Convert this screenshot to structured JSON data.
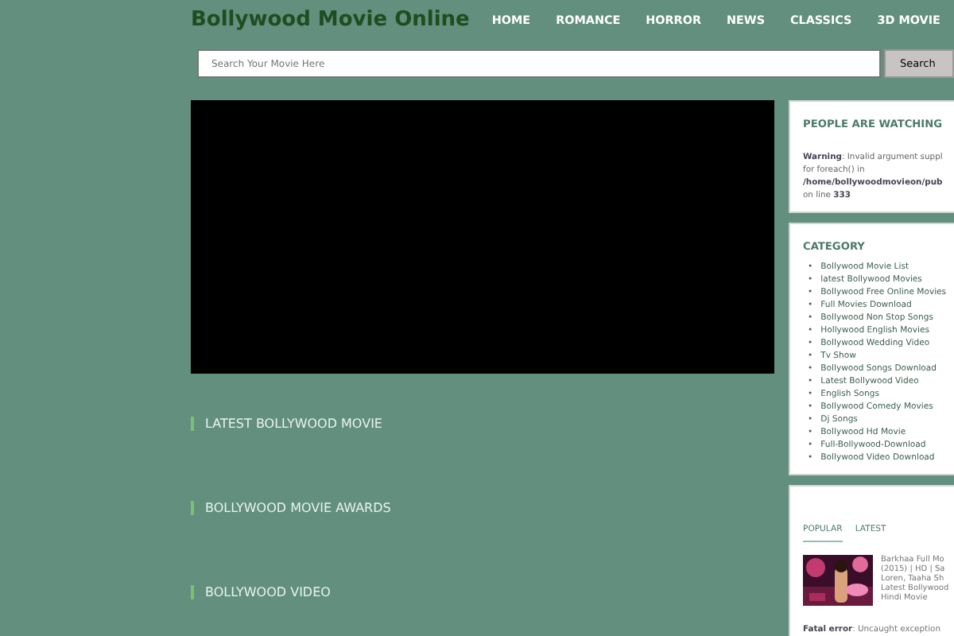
{
  "header": {
    "site_title": "Bollywood Movie Online",
    "nav": [
      "HOME",
      "ROMANCE",
      "HORROR",
      "NEWS",
      "CLASSICS",
      "3D MOVIE"
    ]
  },
  "search": {
    "placeholder": "Search Your Movie Here",
    "button": "Search"
  },
  "main": {
    "video": {
      "kind": "player"
    },
    "sections": [
      "LATEST BOLLYWOOD MOVIE",
      "BOLLYWOOD MOVIE AWARDS",
      "BOLLYWOOD VIDEO"
    ]
  },
  "sidebar": {
    "watching": {
      "title": "PEOPLE ARE WATCHING",
      "message": "**Warning**: Invalid argument suppl\nfor foreach() in\n**/home/bollywoodmovieon/pub**\non line **333**"
    },
    "category": {
      "title": "CATEGORY",
      "bullet": "•",
      "items": [
        "Bollywood Movie List",
        "latest Bollywood Movies",
        "Bollywood Free Online Movies",
        "Full Movies Download",
        "Bollywood Non Stop Songs",
        "Hollywood English Movies",
        "Bollywood Wedding Video",
        "Tv Show",
        "Bollywood Songs Download",
        "Latest Bollywood Video",
        "English Songs",
        "Bollywood Comedy Movies",
        "Dj Songs",
        "Bollywood Hd Movie",
        "Full-Bollywood-Download",
        "Bollywood Video Download"
      ]
    },
    "posts": {
      "tabs": [
        {
          "label": "POPULAR",
          "selected": true
        },
        {
          "label": "LATEST",
          "selected": false
        }
      ],
      "items": [
        {
          "title": "Barkhaa Full Mo\n(2015) | HD | Sa\nLoren, Taaha Sh\nLatest Bollywood\nHindi Movie"
        }
      ],
      "error": "**Fatal error**: Uncaught exception"
    }
  }
}
